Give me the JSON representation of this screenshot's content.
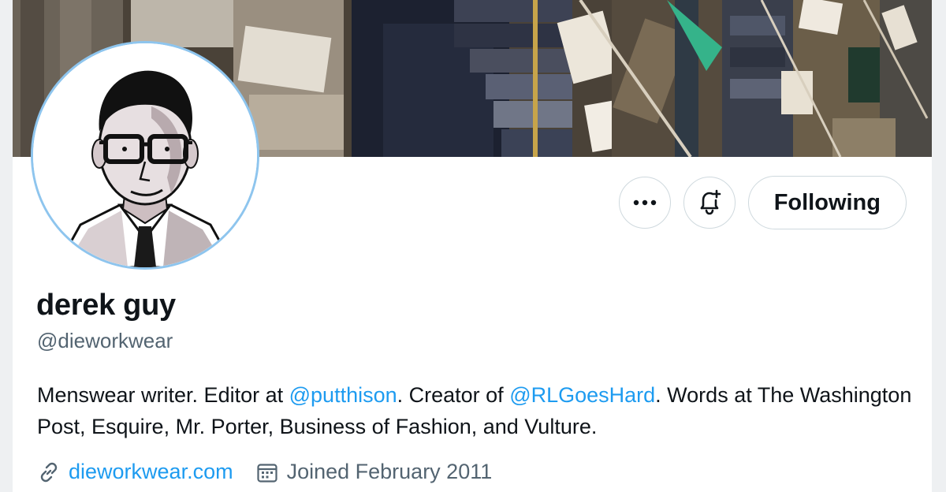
{
  "profile": {
    "display_name": "derek guy",
    "handle": "@dieworkwear",
    "bio": {
      "part1": "Menswear writer. Editor at ",
      "mention1": "@putthison",
      "part2": ". Creator of ",
      "mention2": "@RLGoesHard",
      "part3": ". Words at The Washington Post, Esquire, Mr. Porter, Business of Fashion, and Vulture."
    },
    "website": "dieworkwear.com",
    "joined": "Joined February 2011"
  },
  "actions": {
    "more_icon": "more-horizontal-icon",
    "notify_icon": "bell-plus-icon",
    "follow_label": "Following"
  },
  "colors": {
    "link": "#1d9bf0",
    "secondary_text": "#536471",
    "border": "#cfd9de",
    "avatar_ring": "#8ec5ee"
  }
}
